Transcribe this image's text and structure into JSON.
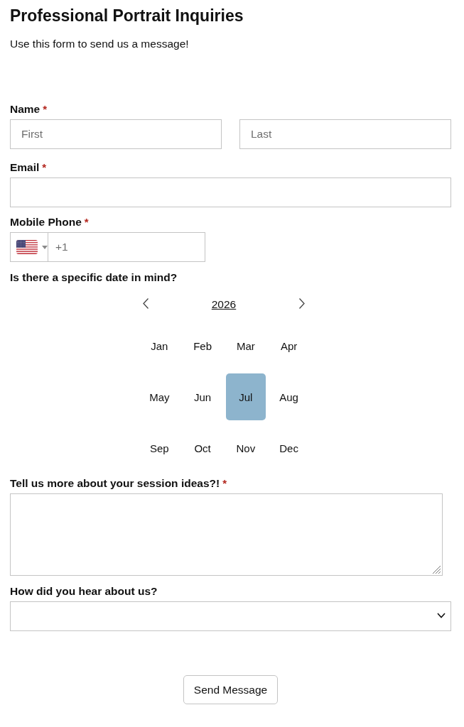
{
  "header": {
    "title": "Professional Portrait Inquiries",
    "subtitle": "Use this form to send us a message!"
  },
  "name": {
    "label": "Name",
    "required_mark": "*",
    "first": {
      "placeholder": "First"
    },
    "last": {
      "placeholder": "Last"
    }
  },
  "email": {
    "label": "Email",
    "required_mark": "*"
  },
  "phone": {
    "label": "Mobile Phone",
    "required_mark": "*",
    "placeholder": "+1"
  },
  "date": {
    "label": "Is there a specific date in mind?",
    "year": "2026",
    "months": [
      {
        "label": "Jan",
        "selected": false
      },
      {
        "label": "Feb",
        "selected": false
      },
      {
        "label": "Mar",
        "selected": false
      },
      {
        "label": "Apr",
        "selected": false
      },
      {
        "label": "May",
        "selected": false
      },
      {
        "label": "Jun",
        "selected": false
      },
      {
        "label": "Jul",
        "selected": true
      },
      {
        "label": "Aug",
        "selected": false
      },
      {
        "label": "Sep",
        "selected": false
      },
      {
        "label": "Oct",
        "selected": false
      },
      {
        "label": "Nov",
        "selected": false
      },
      {
        "label": "Dec",
        "selected": false
      }
    ]
  },
  "ideas": {
    "label": "Tell us more about your session ideas?!",
    "required_mark": "*"
  },
  "referral": {
    "label": "How did you hear about us?"
  },
  "submit": {
    "label": "Send Message"
  }
}
